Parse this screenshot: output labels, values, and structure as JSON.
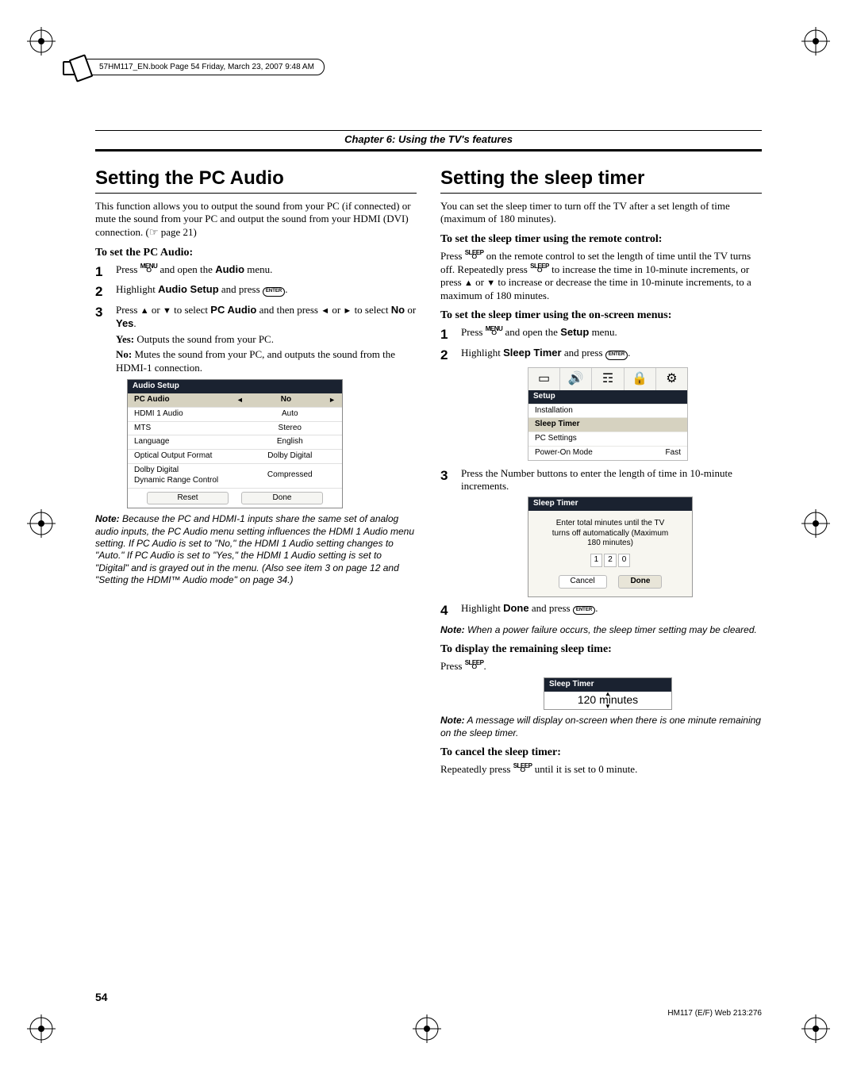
{
  "meta": {
    "book_line": "57HM117_EN.book  Page 54  Friday, March 23, 2007  9:48 AM",
    "chapter": "Chapter 6: Using the TV's features",
    "page_number": "54",
    "rev": "HM117 (E/F) Web 213:276"
  },
  "left": {
    "title": "Setting the PC Audio",
    "intro": "This function allows you to output the sound from your PC (if connected) or mute the sound from your PC and output the sound from your HDMI (DVI) connection. (☞ page 21)",
    "subhead": "To set the PC Audio:",
    "steps": [
      {
        "num": "1",
        "text_a": "Press ",
        "key_top": "MENU",
        "key_bot": "⭘",
        "text_b": " and open the ",
        "bold": "Audio",
        "text_c": " menu."
      },
      {
        "num": "2",
        "text_a": "Highlight ",
        "bold": "Audio Setup",
        "text_b": " and press ",
        "enter": "ENTER",
        "text_c": "."
      },
      {
        "num": "3",
        "text_a": "Press ",
        "arr1": "▲",
        "text_b": " or ",
        "arr2": "▼",
        "text_c": " to select ",
        "bold": "PC Audio",
        "text_d": " and then press ",
        "arr3": "◄",
        "text_e": " or ",
        "arr4": "►",
        "text_f": " to select ",
        "bold2": "No",
        "text_g": " or ",
        "bold3": "Yes",
        "text_h": "."
      }
    ],
    "yes_label": "Yes:",
    "yes_text": " Outputs the sound from your PC.",
    "no_label": "No:",
    "no_text": " Mutes the sound from your PC, and outputs the sound from the HDMI-1 connection.",
    "panel": {
      "title": "Audio Setup",
      "hl_left": "PC Audio",
      "hl_right": "No",
      "rows": [
        {
          "l": "HDMI 1 Audio",
          "r": "Auto"
        },
        {
          "l": "MTS",
          "r": "Stereo"
        },
        {
          "l": "Language",
          "r": "English"
        },
        {
          "l": "Optical Output Format",
          "r": "Dolby Digital"
        },
        {
          "l": "Dolby Digital\nDynamic Range Control",
          "r": "Compressed"
        }
      ],
      "btn_reset": "Reset",
      "btn_done": "Done"
    },
    "note_lead": "Note:",
    "note_body": " Because the PC and HDMI-1 inputs share the same set of analog audio inputs, the PC Audio menu setting influences the HDMI 1 Audio menu setting. If PC Audio is set to \"No,\" the HDMI 1 Audio setting changes to \"Auto.\" If PC Audio is set to \"Yes,\" the HDMI 1 Audio setting is set to \"Digital\" and is grayed out in the menu. (Also see item 3 on page 12 and \"Setting the HDMI™ Audio mode\" on page 34.)"
  },
  "right": {
    "title": "Setting the sleep timer",
    "intro": "You can set the sleep timer to turn off the TV after a set length of time (maximum of 180 minutes).",
    "subhead1": "To set the sleep timer using the remote control:",
    "remote_line_a": "Press ",
    "sleep_key_top": "SLEEP",
    "sleep_key_bot": "⭘",
    "remote_line_b": " on the remote control to set the length of time until the TV turns off. Repeatedly press ",
    "remote_line_c": " to increase the time in 10-minute increments, or press ",
    "arr_up": "▲",
    "remote_line_d": " or ",
    "arr_down": "▼",
    "remote_line_e": " to increase or decrease the time in 10-minute increments, to a maximum of 180 minutes.",
    "subhead2": "To set the sleep timer using the on-screen menus:",
    "steps": [
      {
        "num": "1",
        "text_a": "Press ",
        "key_top": "MENU",
        "key_bot": "⭘",
        "text_b": " and open the ",
        "bold": "Setup",
        "text_c": " menu."
      },
      {
        "num": "2",
        "text_a": "Highlight ",
        "bold": "Sleep Timer",
        "text_b": " and press ",
        "enter": "ENTER",
        "text_c": "."
      }
    ],
    "setup_panel": {
      "bar": "Setup",
      "rows": [
        {
          "l": "Installation",
          "r": ""
        },
        {
          "l": "Sleep Timer",
          "r": "",
          "hl": true
        },
        {
          "l": "PC Settings",
          "r": ""
        },
        {
          "l": "Power-On Mode",
          "r": "Fast"
        }
      ]
    },
    "step3_num": "3",
    "step3_text": "Press the Number buttons to enter the length of time in 10-minute increments.",
    "dialog": {
      "bar": "Sleep Timer",
      "msg1": "Enter total minutes until the TV",
      "msg2": "turns off automatically (Maximum",
      "msg3": "180 minutes)",
      "d1": "1",
      "d2": "2",
      "d3": "0",
      "cancel": "Cancel",
      "done": "Done"
    },
    "step4_num": "4",
    "step4_a": "Highlight ",
    "step4_bold": "Done",
    "step4_b": " and press ",
    "step4_enter": "ENTER",
    "step4_c": ".",
    "note1_lead": "Note:",
    "note1_body": " When a power failure occurs, the sleep timer setting may be cleared.",
    "subhead3": "To display the remaining sleep time:",
    "display_line_a": "Press ",
    "readout": {
      "bar": "Sleep Timer",
      "value": "120 minutes"
    },
    "note2_lead": "Note:",
    "note2_body": " A message will display on-screen when there is one minute remaining on the sleep timer.",
    "subhead4": "To cancel the sleep timer:",
    "cancel_line_a": "Repeatedly press ",
    "cancel_line_b": " until it is set to 0 minute."
  }
}
